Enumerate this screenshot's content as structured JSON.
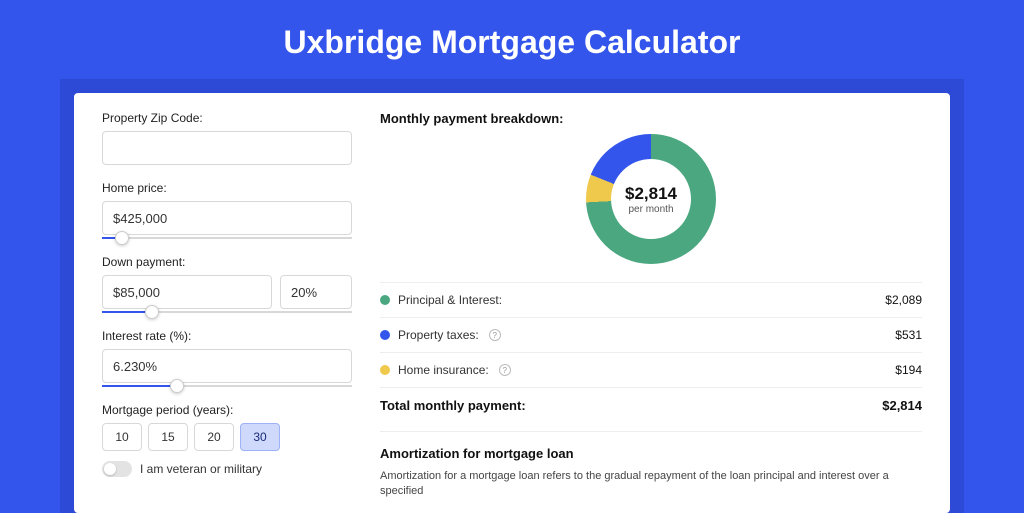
{
  "title": "Uxbridge Mortgage Calculator",
  "form": {
    "zip_label": "Property Zip Code:",
    "zip_value": "",
    "home_price_label": "Home price:",
    "home_price_value": "$425,000",
    "home_price_slider_pct": 8,
    "down_payment_label": "Down payment:",
    "down_payment_value": "$85,000",
    "down_payment_pct_value": "20%",
    "down_payment_slider_pct": 20,
    "interest_label": "Interest rate (%):",
    "interest_value": "6.230%",
    "interest_slider_pct": 30,
    "period_label": "Mortgage period (years):",
    "periods": [
      "10",
      "15",
      "20",
      "30"
    ],
    "period_active": "30",
    "veteran_label": "I am veteran or military"
  },
  "breakdown": {
    "title": "Monthly payment breakdown:",
    "center_value": "$2,814",
    "center_sub": "per month",
    "items": [
      {
        "label": "Principal & Interest:",
        "value": "$2,089",
        "color": "#4aa77f",
        "info": false
      },
      {
        "label": "Property taxes:",
        "value": "$531",
        "color": "#3455eb",
        "info": true
      },
      {
        "label": "Home insurance:",
        "value": "$194",
        "color": "#efc94c",
        "info": true
      }
    ],
    "total_label": "Total monthly payment:",
    "total_value": "$2,814"
  },
  "chart_data": {
    "type": "pie",
    "title": "Monthly payment breakdown",
    "series": [
      {
        "name": "Principal & Interest",
        "value": 2089,
        "color": "#4aa77f"
      },
      {
        "name": "Property taxes",
        "value": 531,
        "color": "#3455eb"
      },
      {
        "name": "Home insurance",
        "value": 194,
        "color": "#efc94c"
      }
    ],
    "total": 2814,
    "unit": "USD per month"
  },
  "amort": {
    "title": "Amortization for mortgage loan",
    "text": "Amortization for a mortgage loan refers to the gradual repayment of the loan principal and interest over a specified"
  }
}
